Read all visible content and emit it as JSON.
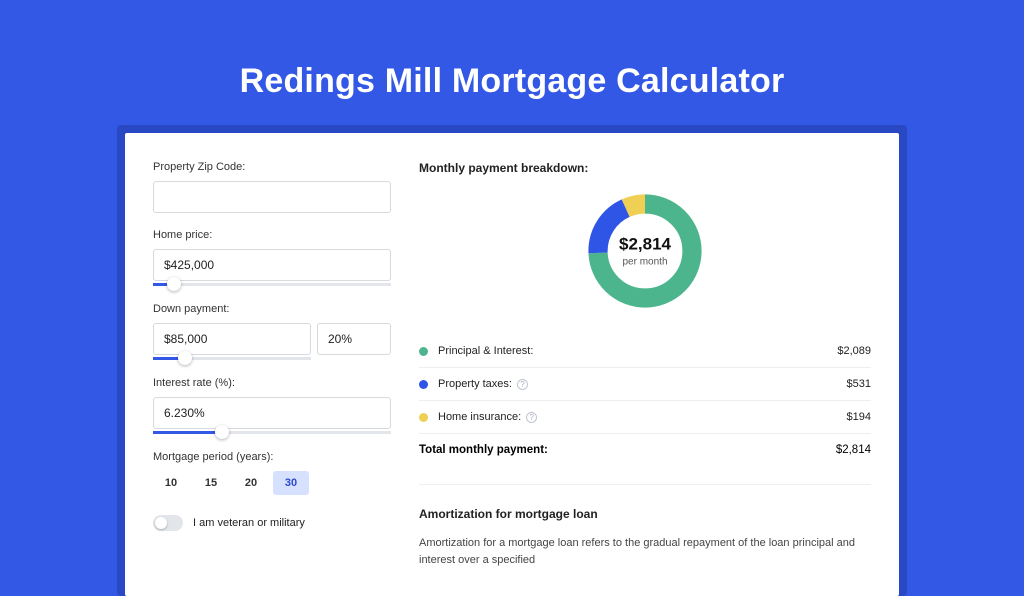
{
  "page_title": "Redings Mill Mortgage Calculator",
  "form": {
    "zip_label": "Property Zip Code:",
    "zip_value": "",
    "home_price_label": "Home price:",
    "home_price_value": "$425,000",
    "home_price_slider_pct": 9,
    "down_payment_label": "Down payment:",
    "down_payment_value": "$85,000",
    "down_payment_pct_value": "20%",
    "down_payment_slider_pct": 20,
    "interest_label": "Interest rate (%):",
    "interest_value": "6.230%",
    "interest_slider_pct": 29,
    "period_label": "Mortgage period (years):",
    "periods": [
      "10",
      "15",
      "20",
      "30"
    ],
    "period_active_index": 3,
    "veteran_label": "I am veteran or military"
  },
  "breakdown": {
    "title": "Monthly payment breakdown:",
    "total_amount": "$2,814",
    "total_sub": "per month",
    "rows": [
      {
        "label": "Principal & Interest:",
        "value": "$2,089",
        "color": "#4db58e",
        "has_info": false
      },
      {
        "label": "Property taxes:",
        "value": "$531",
        "color": "#2f55e6",
        "has_info": true
      },
      {
        "label": "Home insurance:",
        "value": "$194",
        "color": "#f0cf55",
        "has_info": true
      }
    ],
    "total_label": "Total monthly payment:",
    "total_value": "$2,814"
  },
  "chart_data": {
    "type": "pie",
    "title": "Monthly payment breakdown",
    "series": [
      {
        "name": "Principal & Interest",
        "value": 2089,
        "color": "#4db58e"
      },
      {
        "name": "Property taxes",
        "value": 531,
        "color": "#2f55e6"
      },
      {
        "name": "Home insurance",
        "value": 194,
        "color": "#f0cf55"
      }
    ],
    "total": 2814,
    "center_label": "$2,814",
    "center_sub": "per month"
  },
  "amortization": {
    "title": "Amortization for mortgage loan",
    "text": "Amortization for a mortgage loan refers to the gradual repayment of the loan principal and interest over a specified"
  }
}
